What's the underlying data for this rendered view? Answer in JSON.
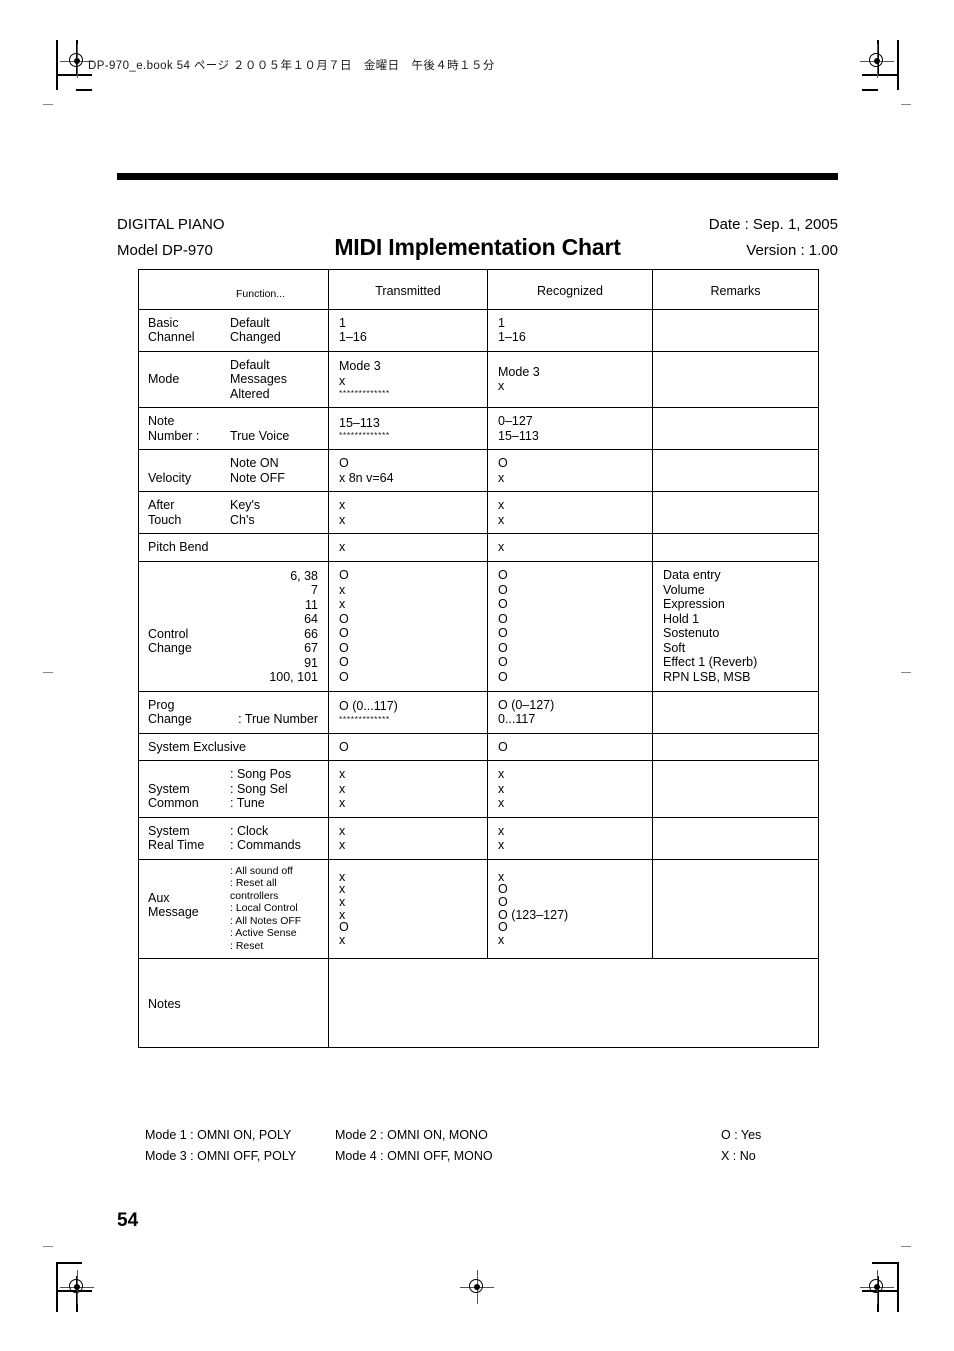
{
  "book_header": "DP-970_e.book 54 ページ ２００５年１０月７日　金曜日　午後４時１５分",
  "doc": {
    "product": "DIGITAL PIANO",
    "model": "Model DP-970",
    "title": "MIDI Implementation Chart",
    "date": "Date : Sep. 1, 2005",
    "version": "Version : 1.00"
  },
  "table": {
    "headers": {
      "function": "Function...",
      "transmitted": "Transmitted",
      "recognized": "Recognized",
      "remarks": "Remarks"
    },
    "rows": {
      "basic_channel": {
        "major": "Basic\nChannel",
        "major_l1": "Basic",
        "major_l2": "Channel",
        "minor_l1": "Default",
        "minor_l2": "Changed",
        "transmitted_l1": "1",
        "transmitted_l2": "1–16",
        "recognized_l1": "1",
        "recognized_l2": "1–16",
        "remarks": ""
      },
      "mode": {
        "major": "Mode",
        "minor_l1": "Default",
        "minor_l2": "Messages",
        "minor_l3": "Altered",
        "transmitted_l1": "Mode 3",
        "transmitted_l2": "x",
        "transmitted_l3": "*************",
        "recognized_l1": "Mode 3",
        "recognized_l2": "x",
        "remarks": ""
      },
      "note_number": {
        "major_l1": "Note",
        "major_l2": "Number :",
        "minor": "True Voice",
        "transmitted_l1": "15–113",
        "transmitted_l2": "*************",
        "recognized_l1": "0–127",
        "recognized_l2": "15–113",
        "remarks": ""
      },
      "velocity": {
        "major": "Velocity",
        "minor_l1": "Note ON",
        "minor_l2": "Note OFF",
        "transmitted_l1": "O",
        "transmitted_l2": "x    8n v=64",
        "recognized_l1": "O",
        "recognized_l2": "x",
        "remarks": ""
      },
      "after_touch": {
        "major_l1": "After",
        "major_l2": "Touch",
        "minor_l1": "Key's",
        "minor_l2": "Ch's",
        "transmitted_l1": "x",
        "transmitted_l2": "x",
        "recognized_l1": "x",
        "recognized_l2": "x",
        "remarks": ""
      },
      "pitch_bend": {
        "major": "Pitch Bend",
        "minor": "",
        "transmitted": "x",
        "recognized": "x",
        "remarks": ""
      },
      "control_change": {
        "major_l1": "Control",
        "major_l2": "Change",
        "numbers": [
          "6, 38",
          "7",
          "11",
          "64",
          "66",
          "67",
          "91",
          "100, 101"
        ],
        "transmitted": [
          "O",
          "x",
          "x",
          "O",
          "O",
          "O",
          "O",
          "O"
        ],
        "recognized": [
          "O",
          "O",
          "O",
          "O",
          "O",
          "O",
          "O",
          "O"
        ],
        "remarks": [
          "Data entry",
          "Volume",
          "Expression",
          "Hold 1",
          "Sostenuto",
          "Soft",
          "Effect 1 (Reverb)",
          "RPN LSB, MSB"
        ]
      },
      "prog_change": {
        "major_l1": "Prog",
        "major_l2": "Change",
        "minor": ": True Number",
        "transmitted_l1": "O (0...117)",
        "transmitted_l2": "*************",
        "recognized_l1": "O (0–127)",
        "recognized_l2": "0...117",
        "remarks": ""
      },
      "system_exclusive": {
        "major": "System Exclusive",
        "transmitted": "O",
        "recognized": "O",
        "remarks": ""
      },
      "system_common": {
        "major_l1": "System",
        "major_l2": "Common",
        "minor": [
          ": Song Pos",
          ": Song Sel",
          ": Tune"
        ],
        "transmitted": [
          "x",
          "x",
          "x"
        ],
        "recognized": [
          "x",
          "x",
          "x"
        ],
        "remarks": ""
      },
      "system_real_time": {
        "major_l1": "System",
        "major_l2": "Real Time",
        "minor": [
          ": Clock",
          ": Commands"
        ],
        "transmitted": [
          "x",
          "x"
        ],
        "recognized": [
          "x",
          "x"
        ],
        "remarks": ""
      },
      "aux_message": {
        "major_l1": "Aux",
        "major_l2": "Message",
        "minor": [
          ": All sound off",
          ": Reset all controllers",
          ": Local Control",
          ": All Notes OFF",
          ": Active Sense",
          ": Reset"
        ],
        "transmitted": [
          "x",
          "x",
          "x",
          "x",
          "O",
          "x"
        ],
        "recognized": [
          "x",
          "O",
          "O",
          "O  (123–127)",
          "O",
          "x"
        ],
        "remarks": ""
      },
      "notes": {
        "major": "Notes",
        "content": ""
      }
    }
  },
  "legend": {
    "mode1": "Mode 1 : OMNI ON, POLY",
    "mode2": "Mode 2 : OMNI ON, MONO",
    "mode3": "Mode 3 : OMNI OFF, POLY",
    "mode4": "Mode 4 : OMNI OFF, MONO",
    "yes": "O : Yes",
    "no": "X : No"
  },
  "page_number": "54"
}
